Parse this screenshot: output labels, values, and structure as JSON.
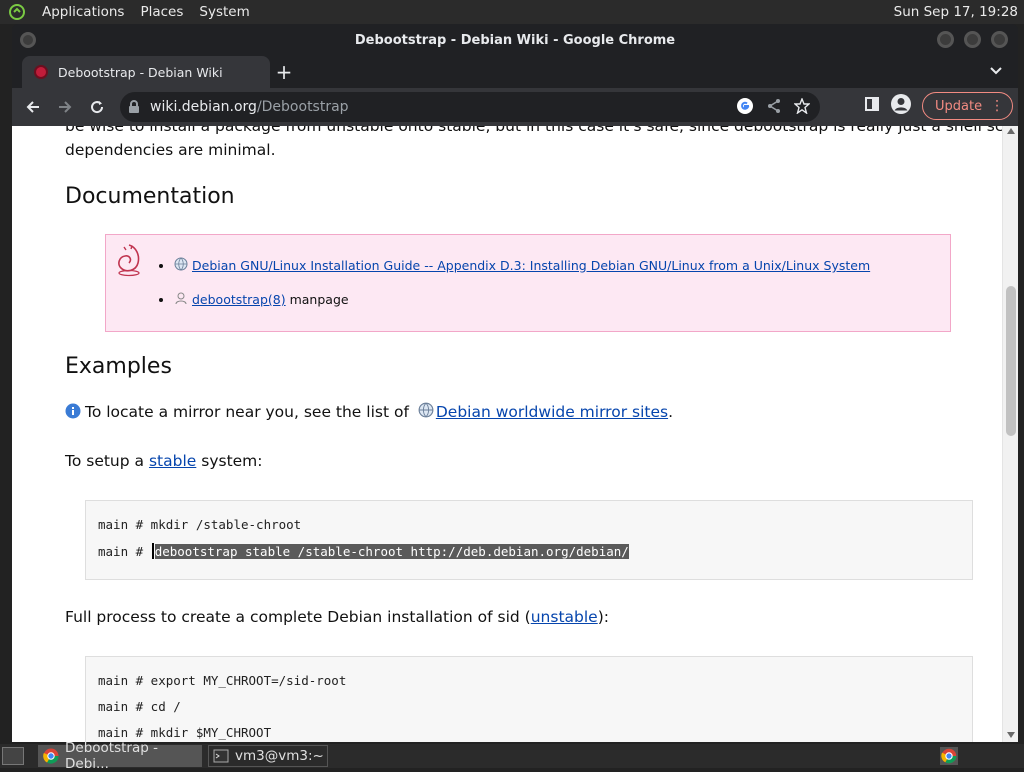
{
  "panel": {
    "menus": [
      "Applications",
      "Places",
      "System"
    ],
    "clock": "Sun Sep 17, 19:28"
  },
  "window": {
    "title": "Debootstrap - Debian Wiki - Google Chrome"
  },
  "tab": {
    "title": "Debootstrap - Debian Wiki",
    "new_tab": "+",
    "tab_search": "⌄"
  },
  "toolbar": {
    "url_host": "wiki.debian.org",
    "url_path": "/Debootstrap",
    "update_label": "Update",
    "menu_dots": "⋮"
  },
  "page": {
    "intro_line1": "be wise to install a package from unstable onto stable, but in this case it's safe, since debootstrap is really just a shell script and its",
    "intro_line2": "dependencies are minimal.",
    "documentation_heading": "Documentation",
    "doc_links": [
      {
        "text": "Debian GNU/Linux Installation Guide -- Appendix D.3: Installing Debian GNU/Linux from a Unix/Linux System",
        "suffix": ""
      },
      {
        "text": "debootstrap(8)",
        "suffix": " manpage"
      }
    ],
    "examples_heading": "Examples",
    "mirror_prefix": "To locate a mirror near you, see the list of",
    "mirror_link": "Debian worldwide mirror sites",
    "mirror_suffix": ".",
    "setup_prefix": "To setup a",
    "setup_link": "stable",
    "setup_suffix": "system:",
    "code1": {
      "line1": "main # mkdir /stable-chroot",
      "line2_prompt": "main #",
      "line2_cmd": "debootstrap stable /stable-chroot http://deb.debian.org/debian/"
    },
    "full_prefix": "Full process to create a complete Debian installation of sid (",
    "full_link": "unstable",
    "full_suffix": "):",
    "code2": {
      "line1": "main # export MY_CHROOT=/sid-root",
      "line2": "main # cd /",
      "line3": "main # mkdir $MY_CHROOT"
    }
  },
  "taskbar": {
    "tasks": [
      "Debootstrap - Debi...",
      "vm3@vm3:~"
    ]
  },
  "colors": {
    "link": "#0645ad",
    "doc_box_bg": "#fde8f3",
    "update_accent": "#f28b82"
  },
  "icons": [
    "debian-logo-icon",
    "back-arrow-icon",
    "forward-arrow-icon",
    "reload-icon",
    "lock-icon",
    "google-icon",
    "share-icon",
    "star-icon",
    "side-panel-icon",
    "profile-icon",
    "info-icon",
    "globe-icon",
    "chrome-icon",
    "terminal-icon"
  ]
}
